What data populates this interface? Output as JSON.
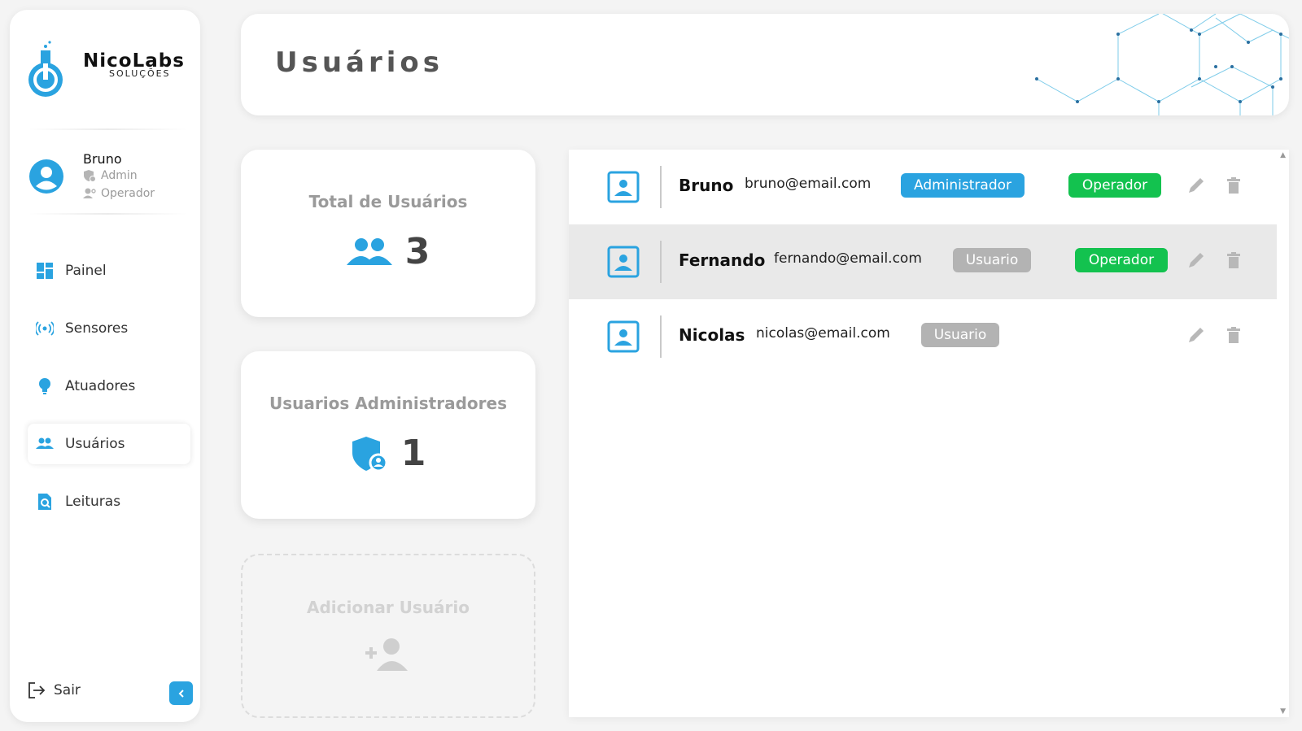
{
  "brand": {
    "name": "NicoLabs",
    "subtitle": "SOLUÇÕES"
  },
  "user": {
    "name": "Bruno",
    "roles": [
      "Admin",
      "Operador"
    ]
  },
  "nav": [
    {
      "label": "Painel",
      "icon": "dashboard-icon"
    },
    {
      "label": "Sensores",
      "icon": "broadcast-icon"
    },
    {
      "label": "Atuadores",
      "icon": "bulb-icon"
    },
    {
      "label": "Usuários",
      "icon": "users-icon",
      "active": true
    },
    {
      "label": "Leituras",
      "icon": "search-document-icon"
    }
  ],
  "logout": {
    "label": "Sair"
  },
  "header": {
    "title": "Usuários"
  },
  "cards": {
    "total": {
      "title": "Total de Usuários",
      "value": "3"
    },
    "admins": {
      "title": "Usuarios Administradores",
      "value": "1"
    },
    "add": {
      "title": "Adicionar Usuário"
    }
  },
  "users": [
    {
      "name": "Bruno",
      "email": "bruno@email.com",
      "role": "Administrador",
      "operator": "Operador"
    },
    {
      "name": "Fernando",
      "email": "fernando@email.com",
      "role": "Usuario",
      "operator": "Operador"
    },
    {
      "name": "Nicolas",
      "email": "nicolas@email.com",
      "role": "Usuario",
      "operator": ""
    }
  ],
  "colors": {
    "accent": "#2aa3e0",
    "operator": "#13c24f",
    "user_badge": "#b3b3b3"
  }
}
